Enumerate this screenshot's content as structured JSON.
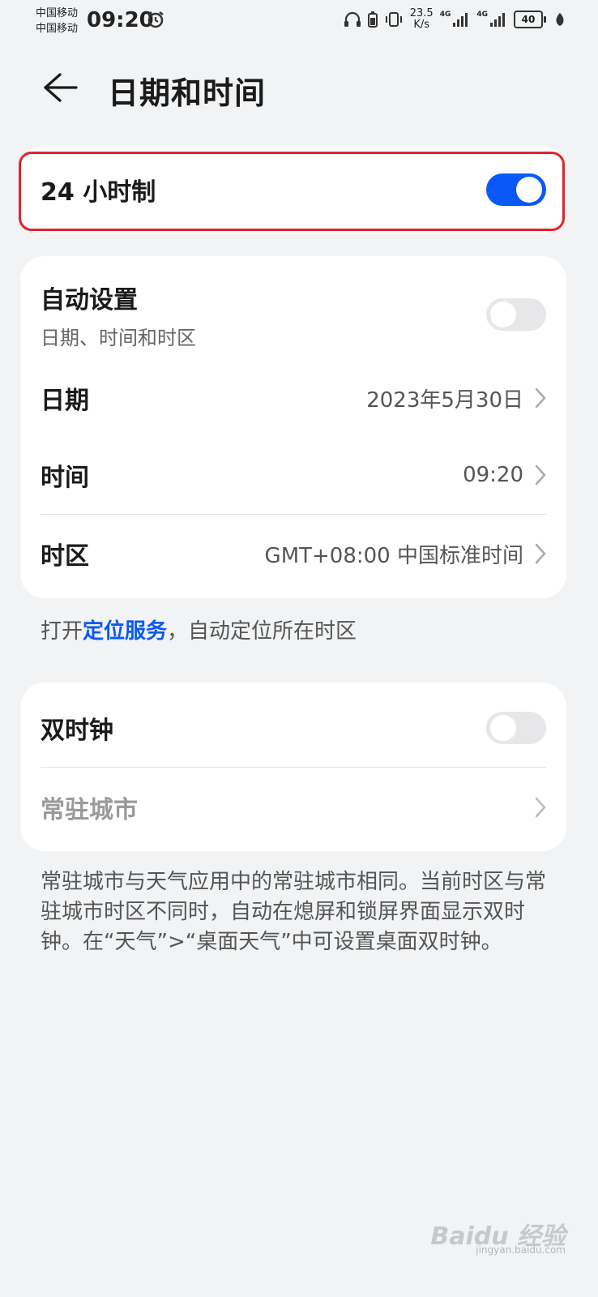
{
  "status_bar": {
    "carrier_1": "中国移动",
    "carrier_2": "中国移动",
    "time": "09:20",
    "net_speed_value": "23.5",
    "net_speed_unit": "K/s",
    "signal_1_label": "4G",
    "signal_2_label": "4G",
    "battery": "40"
  },
  "header": {
    "title": "日期和时间"
  },
  "format_card": {
    "label": "24 小时制",
    "toggle_on": true
  },
  "auto_card": {
    "auto_label": "自动设置",
    "auto_sub": "日期、时间和时区",
    "date_label": "日期",
    "date_value": "2023年5月30日",
    "time_label": "时间",
    "time_value": "09:20",
    "tz_label": "时区",
    "tz_value": "GMT+08:00 中国标准时间"
  },
  "location_hint": {
    "prefix": "打开",
    "link": "定位服务",
    "suffix": "，自动定位所在时区"
  },
  "dual_card": {
    "dual_label": "双时钟",
    "city_label": "常驻城市"
  },
  "note": "常驻城市与天气应用中的常驻城市相同。当前时区与常驻城市时区不同时，自动在熄屏和锁屏界面显示双时钟。在“天气”>“桌面天气”中可设置桌面双时钟。",
  "watermark": {
    "brand": "Baidu 经验",
    "url": "jingyan.baidu.com"
  },
  "colors": {
    "accent": "#0a59f7",
    "highlight_border": "#e0232e",
    "background": "#f1f3f5"
  }
}
